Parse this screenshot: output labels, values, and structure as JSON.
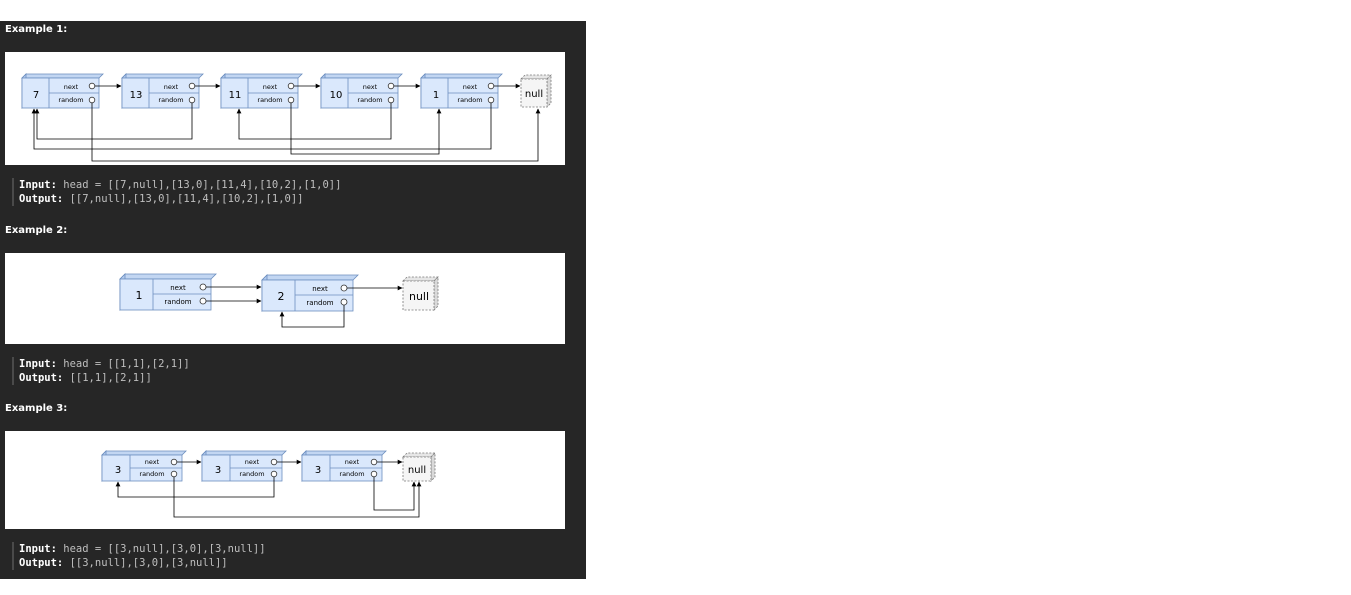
{
  "examples": [
    {
      "title": "Example 1:",
      "input_label": "Input:",
      "input_value": "head = [[7,null],[13,0],[11,4],[10,2],[1,0]]",
      "output_label": "Output:",
      "output_value": "[[7,null],[13,0],[11,4],[10,2],[1,0]]",
      "diagram": {
        "nodes": [
          "7",
          "13",
          "11",
          "10",
          "1"
        ],
        "null_label": "null",
        "next_label": "next",
        "random_label": "random"
      }
    },
    {
      "title": "Example 2:",
      "input_label": "Input:",
      "input_value": "head = [[1,1],[2,1]]",
      "output_label": "Output:",
      "output_value": "[[1,1],[2,1]]",
      "diagram": {
        "nodes": [
          "1",
          "2"
        ],
        "null_label": "null",
        "next_label": "next",
        "random_label": "random"
      }
    },
    {
      "title": "Example 3:",
      "input_label": "Input:",
      "input_value": "head = [[3,null],[3,0],[3,null]]",
      "output_label": "Output:",
      "output_value": "[[3,null],[3,0],[3,null]]",
      "diagram": {
        "nodes": [
          "3",
          "3",
          "3"
        ],
        "null_label": "null",
        "next_label": "next",
        "random_label": "random"
      }
    }
  ],
  "colors": {
    "panel_bg": "#262626",
    "node_fill": "#dae8fc",
    "node_stroke": "#6c8ebf",
    "null_fill": "#f5f5f5",
    "arrow": "#000000"
  }
}
